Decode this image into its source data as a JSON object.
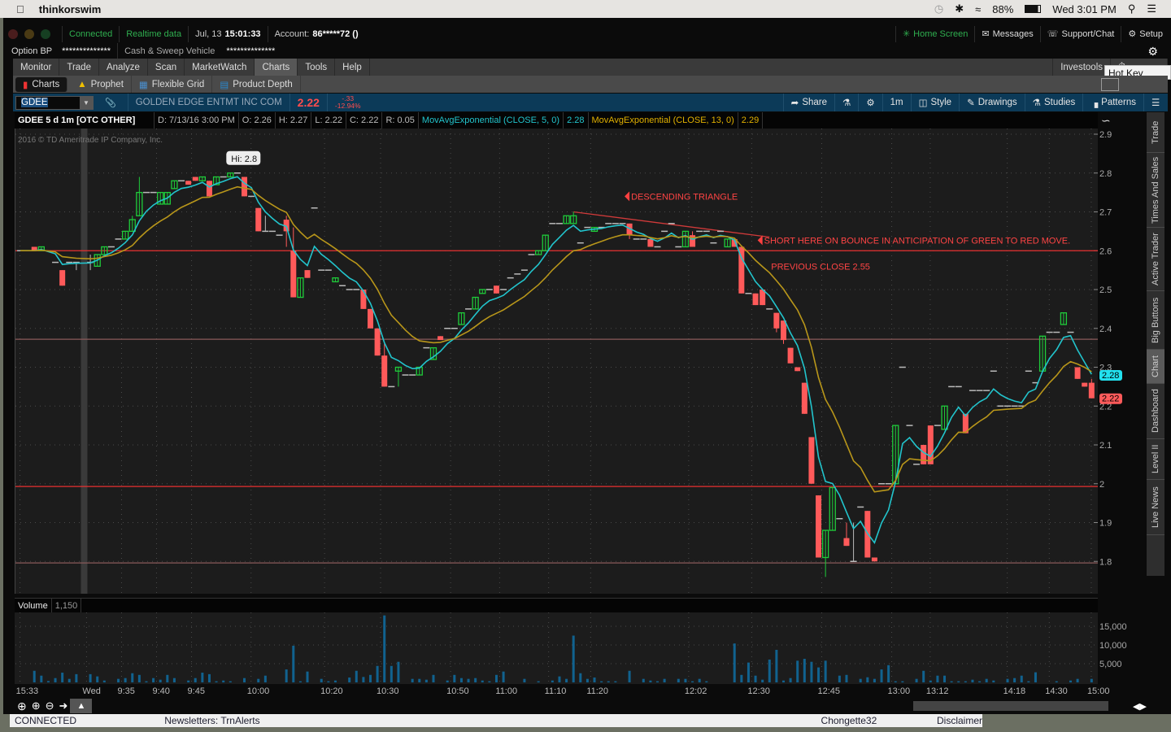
{
  "menubar": {
    "app": "thinkorswim",
    "battery": "88%",
    "clock": "Wed 3:01 PM"
  },
  "topbar": {
    "connected": "Connected",
    "realtime": "Realtime data",
    "date": "Jul, 13",
    "time": "15:01:33",
    "account_label": "Account:",
    "account": "86*****72 ()",
    "home": "Home Screen",
    "messages": "Messages",
    "support": "Support/Chat",
    "setup": "Setup"
  },
  "bp": {
    "option_bp": "Option BP",
    "option_bp_val": "**************",
    "cash": "Cash & Sweep Vehicle",
    "cash_val": "**************"
  },
  "menu": {
    "tabs": [
      "Monitor",
      "Trade",
      "Analyze",
      "Scan",
      "MarketWatch",
      "Charts",
      "Tools",
      "Help"
    ],
    "selected": "Charts",
    "investools": "Investools"
  },
  "tooltip": "Hot Key Setup",
  "subtabs": [
    "Charts",
    "Prophet",
    "Flexible Grid",
    "Product Depth"
  ],
  "symbolbar": {
    "symbol": "GDEE",
    "name": "GOLDEN EDGE ENTMT INC COM",
    "last": "2.22",
    "change": "-.33",
    "change_pct": "-12.94%",
    "share": "Share",
    "period": "1m",
    "style": "Style",
    "drawings": "Drawings",
    "studies": "Studies",
    "patterns": "Patterns"
  },
  "header": {
    "title": "GDEE 5 d 1m [OTC OTHER]",
    "date": "D: 7/13/16 3:00 PM",
    "open": "O: 2.26",
    "high": "H: 2.27",
    "low": "L: 2.22",
    "close": "C: 2.22",
    "range": "R: 0.05",
    "ema5_label": "MovAvgExponential (CLOSE, 5, 0)",
    "ema5_val": "2.28",
    "ema13_label": "MovAvgExponential (CLOSE, 13, 0)",
    "ema13_val": "2.29"
  },
  "watermark": "2016 © TD Ameritrade IP Company, Inc.",
  "right_tabs": [
    "Trade",
    "Times And Sales",
    "Active Trader",
    "Big Buttons",
    "Chart",
    "Dashboard",
    "Level II",
    "Live News"
  ],
  "right_tab_selected": "Chart",
  "volume_header": {
    "label": "Volume",
    "value": "1,150"
  },
  "statusbar": {
    "connected": "CONNECTED",
    "newsletters": "Newsletters:  TrnAlerts",
    "user": "Chongette32",
    "disclaimer": "Disclaimer"
  },
  "colors": {
    "up": "#1fcc3a",
    "down": "#ff5a5a",
    "ema5": "#22c4cc",
    "ema13": "#b8961a",
    "volume": "#11628f",
    "annotation": "#ff4040"
  },
  "chart_data": {
    "type": "candlestick",
    "title": "GDEE 5 d 1m [OTC OTHER]",
    "ylim": [
      1.75,
      2.92
    ],
    "yticks": [
      "2.9",
      "2.8",
      "2.7",
      "2.6",
      "2.5",
      "2.4",
      "2.3",
      "2.2",
      "2.1",
      "2",
      "1.9",
      "1.8"
    ],
    "ytick_values": [
      2.9,
      2.8,
      2.7,
      2.6,
      2.5,
      2.4,
      2.3,
      2.2,
      2.1,
      2.0,
      1.9,
      1.8
    ],
    "xticks": [
      {
        "label": "15:33",
        "bar": 1
      },
      {
        "label": "Wed",
        "bar": 10.5
      },
      {
        "label": "9:35",
        "bar": 15.5
      },
      {
        "label": "9:40",
        "bar": 20.5
      },
      {
        "label": "9:45",
        "bar": 25.5
      },
      {
        "label": "10:00",
        "bar": 34
      },
      {
        "label": "10:20",
        "bar": 44.5
      },
      {
        "label": "10:30",
        "bar": 52.5
      },
      {
        "label": "10:50",
        "bar": 62.5
      },
      {
        "label": "11:00",
        "bar": 69.5
      },
      {
        "label": "11:10",
        "bar": 76.5
      },
      {
        "label": "11:20",
        "bar": 82.5
      },
      {
        "label": "12:02",
        "bar": 96.5
      },
      {
        "label": "12:30",
        "bar": 105.5
      },
      {
        "label": "12:45",
        "bar": 115.5
      },
      {
        "label": "13:00",
        "bar": 125.5
      },
      {
        "label": "13:12",
        "bar": 131
      },
      {
        "label": "14:18",
        "bar": 142
      },
      {
        "label": "14:30",
        "bar": 148
      },
      {
        "label": "15:00",
        "bar": 154
      }
    ],
    "session_break_bar": 9,
    "ema_periods": [
      5,
      13
    ],
    "last_labels": {
      "ema5": "2.28",
      "close": "2.22"
    },
    "hlines": [
      {
        "price": 2.6,
        "strong": true
      },
      {
        "price": 2.372,
        "strong": false
      },
      {
        "price": 1.993,
        "strong": true
      },
      {
        "price": 1.796,
        "strong": false
      }
    ],
    "trendline": {
      "from": {
        "bar": 79,
        "price": 2.7
      },
      "to": {
        "bar": 107,
        "price": 2.635
      }
    },
    "annotations": [
      {
        "text": "DESCENDING TRIANGLE",
        "bar": 87,
        "price": 2.74,
        "arrow": true
      },
      {
        "text": "SHORT HERE ON BOUNCE IN ANTICIPATION OF GREEN TO RED MOVE.",
        "bar": 106,
        "price": 2.627,
        "arrow": true
      },
      {
        "text": "PREVIOUS CLOSE 2.55",
        "bar": 107,
        "price": 2.56,
        "arrow": false
      }
    ],
    "hi_bubble": {
      "text": "Hi: 2.8",
      "bar": 30,
      "price": 2.8
    },
    "candles_ohlc": [
      [
        2.6,
        2.6,
        2.6,
        2.6
      ],
      null,
      [
        2.61,
        2.61,
        2.6,
        2.6
      ],
      [
        2.6,
        2.61,
        2.6,
        2.61
      ],
      null,
      [
        2.57,
        2.57,
        2.57,
        2.57
      ],
      [
        2.55,
        2.55,
        2.51,
        2.51
      ],
      [
        2.57,
        2.57,
        2.57,
        2.57
      ],
      [
        2.57,
        2.57,
        2.55,
        2.57
      ],
      null,
      [
        2.57,
        2.59,
        2.55,
        2.57
      ],
      [
        2.56,
        2.59,
        2.56,
        2.59
      ],
      [
        2.59,
        2.61,
        2.59,
        2.61
      ],
      [
        2.61,
        2.61,
        2.61,
        2.61
      ],
      [
        2.63,
        2.63,
        2.63,
        2.63
      ],
      [
        2.63,
        2.65,
        2.63,
        2.65
      ],
      [
        2.65,
        2.69,
        2.65,
        2.68
      ],
      [
        2.69,
        2.79,
        2.69,
        2.75
      ],
      [
        2.75,
        2.75,
        2.75,
        2.75
      ],
      [
        2.75,
        2.75,
        2.75,
        2.75
      ],
      [
        2.72,
        2.75,
        2.72,
        2.75
      ],
      [
        2.72,
        2.75,
        2.72,
        2.75
      ],
      [
        2.76,
        2.78,
        2.76,
        2.78
      ],
      [
        2.78,
        2.78,
        2.78,
        2.78
      ],
      [
        2.78,
        2.78,
        2.77,
        2.77
      ],
      [
        2.79,
        2.79,
        2.78,
        2.78
      ],
      [
        2.78,
        2.79,
        2.78,
        2.79
      ],
      [
        2.78,
        2.78,
        2.74,
        2.74
      ],
      [
        2.77,
        2.79,
        2.77,
        2.79
      ],
      [
        2.79,
        2.79,
        2.79,
        2.79
      ],
      [
        2.79,
        2.8,
        2.79,
        2.8
      ],
      [
        2.8,
        2.8,
        2.8,
        2.8
      ],
      [
        2.79,
        2.79,
        2.74,
        2.74
      ],
      [
        2.74,
        2.74,
        2.74,
        2.74
      ],
      [
        2.71,
        2.71,
        2.65,
        2.65
      ],
      [
        2.65,
        2.69,
        2.65,
        2.65
      ],
      [
        2.65,
        2.65,
        2.65,
        2.65
      ],
      [
        2.64,
        2.64,
        2.64,
        2.64
      ],
      [
        2.68,
        2.69,
        2.61,
        2.65
      ],
      [
        2.6,
        2.66,
        2.48,
        2.48
      ],
      [
        2.48,
        2.53,
        2.48,
        2.53
      ],
      [
        2.55,
        2.55,
        2.53,
        2.53
      ],
      [
        2.71,
        2.71,
        2.71,
        2.71
      ],
      [
        2.55,
        2.55,
        2.55,
        2.55
      ],
      [
        2.55,
        2.55,
        2.55,
        2.55
      ],
      [
        2.52,
        2.53,
        2.52,
        2.53
      ],
      [
        2.51,
        2.51,
        2.51,
        2.51
      ],
      [
        2.5,
        2.5,
        2.5,
        2.5
      ],
      [
        2.5,
        2.5,
        2.5,
        2.5
      ],
      [
        2.5,
        2.5,
        2.45,
        2.45
      ],
      [
        2.45,
        2.45,
        2.4,
        2.4
      ],
      [
        2.4,
        2.4,
        2.33,
        2.33
      ],
      [
        2.33,
        2.36,
        2.25,
        2.25
      ],
      [
        2.25,
        2.25,
        2.25,
        2.25
      ],
      [
        2.29,
        2.3,
        2.25,
        2.3
      ],
      [
        2.28,
        2.28,
        2.28,
        2.28
      ],
      [
        2.28,
        2.28,
        2.28,
        2.28
      ],
      [
        2.28,
        2.3,
        2.28,
        2.3
      ],
      [
        2.35,
        2.35,
        2.35,
        2.35
      ],
      [
        2.32,
        2.35,
        2.32,
        2.35
      ],
      [
        2.38,
        2.38,
        2.37,
        2.37
      ],
      [
        2.4,
        2.4,
        2.4,
        2.4
      ],
      [
        2.4,
        2.4,
        2.4,
        2.4
      ],
      [
        2.41,
        2.44,
        2.41,
        2.44
      ],
      [
        2.45,
        2.45,
        2.45,
        2.45
      ],
      [
        2.45,
        2.48,
        2.45,
        2.48
      ],
      [
        2.49,
        2.5,
        2.49,
        2.5
      ],
      [
        2.5,
        2.5,
        2.5,
        2.5
      ],
      [
        2.51,
        2.51,
        2.49,
        2.49
      ],
      [
        2.5,
        2.5,
        2.5,
        2.5
      ],
      [
        2.53,
        2.53,
        2.53,
        2.53
      ],
      [
        2.54,
        2.54,
        2.54,
        2.54
      ],
      [
        2.55,
        2.55,
        2.55,
        2.55
      ],
      [
        2.59,
        2.59,
        2.59,
        2.59
      ],
      [
        2.59,
        2.6,
        2.59,
        2.6
      ],
      [
        2.6,
        2.64,
        2.6,
        2.64
      ],
      [
        2.67,
        2.67,
        2.67,
        2.67
      ],
      [
        2.67,
        2.67,
        2.67,
        2.67
      ],
      [
        2.67,
        2.69,
        2.67,
        2.69
      ],
      [
        2.67,
        2.7,
        2.67,
        2.69
      ],
      [
        2.62,
        2.62,
        2.62,
        2.62
      ],
      [
        2.66,
        2.66,
        2.66,
        2.66
      ],
      [
        2.65,
        2.66,
        2.65,
        2.66
      ],
      [
        2.66,
        2.66,
        2.66,
        2.66
      ],
      [
        2.67,
        2.67,
        2.67,
        2.67
      ],
      [
        2.67,
        2.67,
        2.67,
        2.67
      ],
      [
        2.67,
        2.67,
        2.67,
        2.67
      ],
      [
        2.67,
        2.67,
        2.63,
        2.64
      ],
      [
        2.63,
        2.63,
        2.63,
        2.63
      ],
      [
        2.63,
        2.63,
        2.63,
        2.63
      ],
      [
        2.63,
        2.63,
        2.61,
        2.61
      ],
      [
        2.61,
        2.61,
        2.61,
        2.61
      ],
      [
        2.65,
        2.65,
        2.65,
        2.65
      ],
      [
        2.67,
        2.67,
        2.67,
        2.67
      ],
      [
        2.61,
        2.61,
        2.61,
        2.61
      ],
      [
        2.61,
        2.65,
        2.61,
        2.65
      ],
      [
        2.64,
        2.65,
        2.61,
        2.61
      ],
      [
        2.65,
        2.65,
        2.65,
        2.65
      ],
      [
        2.65,
        2.65,
        2.65,
        2.65
      ],
      [
        2.62,
        2.62,
        2.62,
        2.62
      ],
      [
        2.65,
        2.65,
        2.65,
        2.65
      ],
      [
        2.61,
        2.63,
        2.61,
        2.63
      ],
      [
        2.63,
        2.63,
        2.61,
        2.61
      ],
      [
        2.61,
        2.61,
        2.49,
        2.49
      ],
      [
        2.49,
        2.49,
        2.49,
        2.49
      ],
      [
        2.49,
        2.49,
        2.46,
        2.46
      ],
      [
        2.5,
        2.5,
        2.46,
        2.46
      ],
      [
        2.45,
        2.45,
        2.45,
        2.45
      ],
      [
        2.44,
        2.44,
        2.39,
        2.4
      ],
      [
        2.42,
        2.42,
        2.36,
        2.37
      ],
      [
        2.35,
        2.35,
        2.31,
        2.31
      ],
      [
        2.3,
        2.3,
        2.29,
        2.29
      ],
      [
        2.26,
        2.26,
        2.18,
        2.18
      ],
      [
        2.12,
        2.12,
        2.0,
        2.0
      ],
      [
        1.97,
        1.97,
        1.81,
        1.81
      ],
      [
        1.81,
        1.88,
        1.76,
        1.88
      ],
      [
        1.88,
        1.99,
        1.88,
        1.99
      ],
      [
        1.91,
        1.91,
        1.91,
        1.91
      ],
      [
        1.86,
        1.9,
        1.84,
        1.84
      ],
      [
        1.8,
        1.9,
        1.8,
        1.8
      ],
      [
        1.94,
        1.94,
        1.94,
        1.94
      ],
      [
        1.93,
        1.93,
        1.81,
        1.81
      ],
      [
        1.81,
        1.81,
        1.8,
        1.8
      ],
      [
        2.0,
        2.0,
        2.0,
        2.0
      ],
      [
        2.0,
        2.0,
        2.0,
        2.0
      ],
      [
        2.0,
        2.15,
        2.0,
        2.15
      ],
      [
        2.3,
        2.3,
        2.3,
        2.3
      ],
      [
        2.15,
        2.15,
        2.15,
        2.15
      ],
      [
        2.05,
        2.05,
        2.05,
        2.05
      ],
      [
        2.1,
        2.1,
        2.05,
        2.05
      ],
      [
        2.15,
        2.15,
        2.05,
        2.05
      ],
      [
        2.15,
        2.15,
        2.15,
        2.15
      ],
      [
        2.14,
        2.2,
        2.14,
        2.2
      ],
      [
        2.25,
        2.25,
        2.25,
        2.25
      ],
      [
        2.25,
        2.25,
        2.25,
        2.25
      ],
      [
        2.18,
        2.18,
        2.13,
        2.13
      ],
      [
        2.24,
        2.24,
        2.24,
        2.24
      ],
      [
        2.24,
        2.24,
        2.24,
        2.24
      ],
      [
        2.24,
        2.24,
        2.24,
        2.24
      ],
      [
        2.29,
        2.29,
        2.29,
        2.29
      ],
      [
        2.2,
        2.2,
        2.2,
        2.2
      ],
      [
        2.2,
        2.2,
        2.2,
        2.2
      ],
      [
        2.2,
        2.2,
        2.2,
        2.2
      ],
      [
        2.2,
        2.2,
        2.2,
        2.2
      ],
      [
        2.29,
        2.29,
        2.29,
        2.29
      ],
      [
        2.26,
        2.26,
        2.26,
        2.26
      ],
      [
        2.29,
        2.38,
        2.29,
        2.38
      ],
      [
        2.39,
        2.39,
        2.39,
        2.39
      ],
      [
        2.39,
        2.39,
        2.39,
        2.39
      ],
      [
        2.41,
        2.44,
        2.41,
        2.44
      ],
      [
        2.39,
        2.39,
        2.39,
        2.39
      ],
      [
        2.3,
        2.3,
        2.27,
        2.27
      ],
      [
        2.26,
        2.26,
        2.25,
        2.25
      ],
      [
        2.26,
        2.27,
        2.22,
        2.22
      ]
    ],
    "volume": {
      "ylim": [
        0,
        17000
      ],
      "yticks": [
        "15,000",
        "10,000",
        "5,000"
      ],
      "ytick_values": [
        15000,
        10000,
        5000
      ],
      "values": [
        0,
        0,
        3100,
        1800,
        360,
        1150,
        2600,
        940,
        2200,
        0,
        2200,
        1600,
        500,
        0,
        940,
        1150,
        2450,
        2000,
        300,
        1150,
        720,
        2000,
        1150,
        0,
        500,
        1150,
        2600,
        2200,
        300,
        500,
        300,
        0,
        1150,
        0,
        940,
        1800,
        0,
        0,
        3460,
        9800,
        300,
        2900,
        0,
        940,
        300,
        500,
        0,
        1300,
        3100,
        1450,
        2000,
        4400,
        17900,
        4400,
        5500,
        0,
        940,
        940,
        720,
        2000,
        0,
        500,
        2000,
        1150,
        940,
        1150,
        500,
        300,
        2000,
        2900,
        0,
        0,
        940,
        0,
        300,
        0,
        500,
        1600,
        940,
        12500,
        2450,
        940,
        1300,
        300,
        300,
        300,
        0,
        3100,
        0,
        940,
        500,
        300,
        940,
        0,
        940,
        940,
        300,
        940,
        300,
        0,
        0,
        0,
        10400,
        2000,
        5300,
        1800,
        720,
        6100,
        8700,
        500,
        1150,
        5800,
        6300,
        5500,
        4000,
        5800,
        0,
        1800,
        2000,
        0,
        940,
        1370,
        940,
        3460,
        4600,
        300,
        300,
        0,
        940,
        3100,
        500,
        1800,
        1800,
        300,
        300,
        300,
        720,
        300,
        940,
        500,
        0,
        940,
        1150,
        1800,
        300,
        2700,
        0,
        0,
        300,
        0,
        500,
        940,
        0,
        940
      ]
    }
  }
}
